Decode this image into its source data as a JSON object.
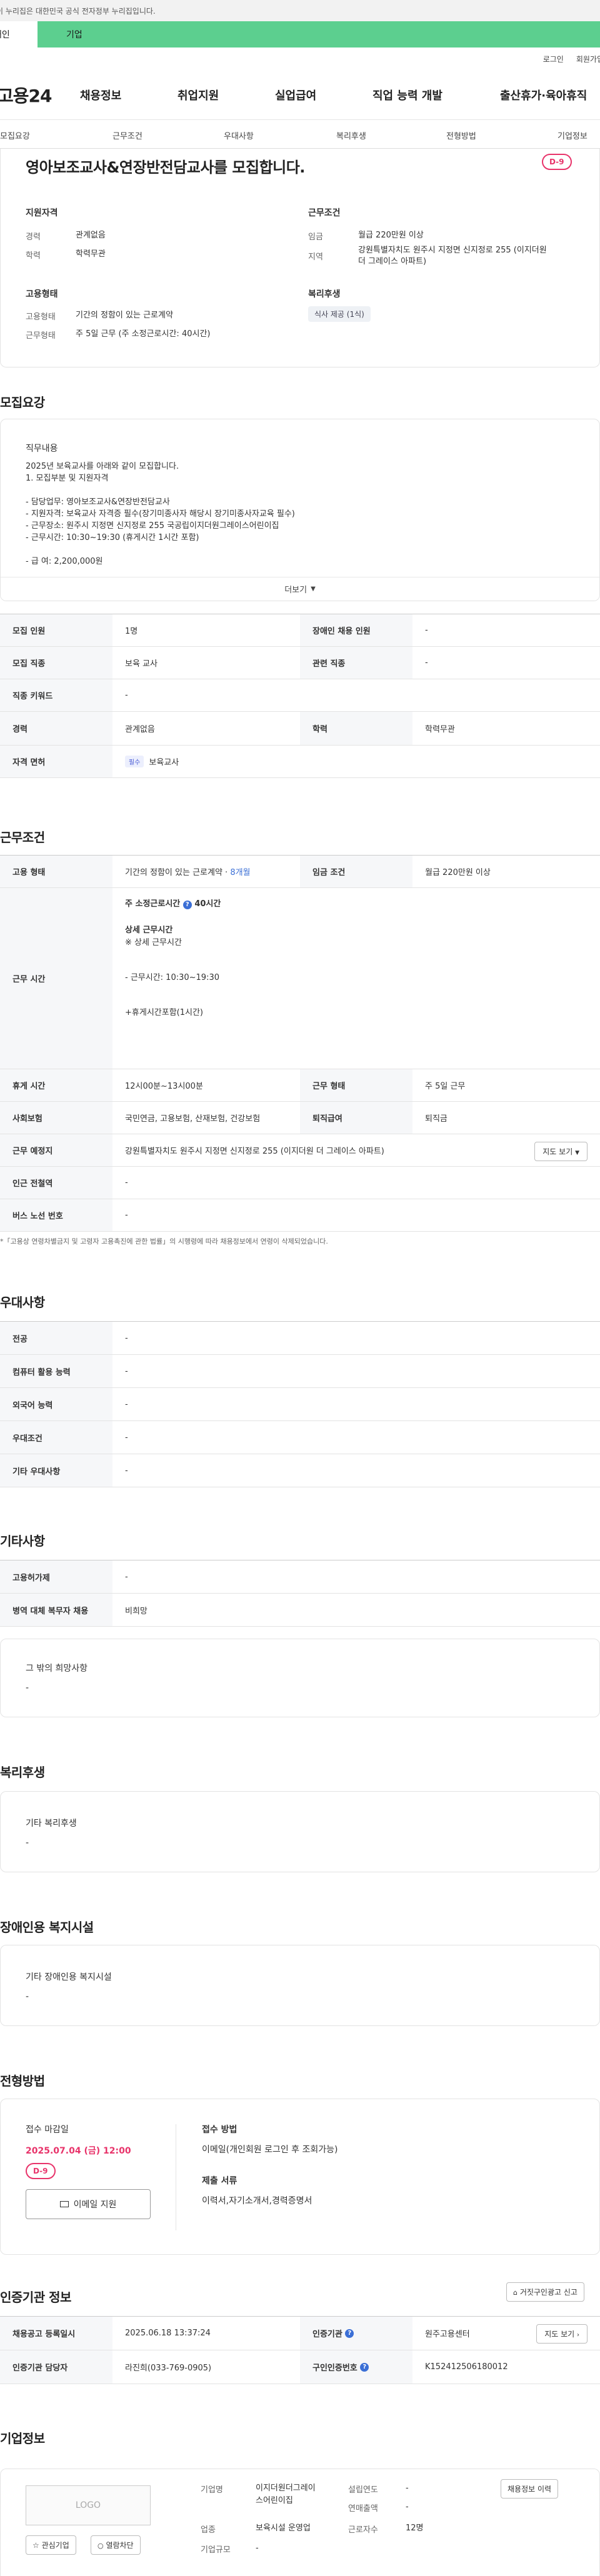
{
  "gov_notice": "이 누리집은 대한민국 공식 전자정부 누리집입니다.",
  "user_tabs": {
    "personal": "개인",
    "company": "기업"
  },
  "util": {
    "login": "로그인",
    "signup": "회원가입"
  },
  "gnb": {
    "logo": "고용24",
    "items": [
      "채용정보",
      "취업지원",
      "실업급여",
      "직업 능력 개발",
      "출산휴가·육아휴직"
    ]
  },
  "section_tabs": [
    "모집요강",
    "근무조건",
    "우대사항",
    "복리후생",
    "전형방법",
    "기업정보"
  ],
  "job": {
    "title": "영아보조교사&연장반전담교사를 모집합니다.",
    "dday": "D-9",
    "qual_h": "지원자격",
    "career_k": "경력",
    "career_v": "관계없음",
    "edu_k": "학력",
    "edu_v": "학력무관",
    "cond_h": "근무조건",
    "wage_k": "임금",
    "wage_v": "월급 220만원 이상",
    "region_k": "지역",
    "region_v1": "강원특별자치도 원주시 지정면 신지정로 255 (이지더원",
    "region_v2": "더 그레이스 아파트)",
    "emp_h": "고용형태",
    "emptype_k": "고용형태",
    "emptype_v": "기간의 정함이 있는 근로계약",
    "worktype_k": "근무형태",
    "worktype_v": "주 5일 근무 (주 소정근로시간: 40시간)",
    "welfare_h": "복리후생",
    "welfare_pill": "식사 제공 (1식)"
  },
  "recruit": {
    "title": "모집요강",
    "duty_h": "직무내용",
    "duty_lines": [
      "2025년 보육교사를 아래와 같이 모집합니다.",
      "1. 모집부분 및 지원자격",
      "",
      "- 담당업무: 영아보조교사&연장반전담교사",
      "- 지원자격: 보육교사 자격증 필수(장기미종사자 해당시 장기미종사자교육 필수)",
      "- 근무장소: 원주시 지정면 신지정로 255 국공립이지더원그레이스어린이집",
      "- 근무시간: 10:30~19:30 (휴게시간 1시간 포함)",
      "",
      "- 급 여: 2,200,000원"
    ],
    "more": "더보기",
    "rows": {
      "count_k": "모집 인원",
      "count_v": "1명",
      "disabled_k": "장애인 채용 인원",
      "disabled_v": "-",
      "job_k": "모집 직종",
      "job_v": "보육 교사",
      "related_k": "관련 직종",
      "related_v": "-",
      "keyword_k": "직종 키워드",
      "keyword_v": "-",
      "career_k": "경력",
      "career_v": "관계없음",
      "edu_k": "학력",
      "edu_v": "학력무관",
      "license_k": "자격 면허",
      "license_tag": "필수",
      "license_v": "보육교사"
    }
  },
  "work": {
    "title": "근무조건",
    "emp_k": "고용 형태",
    "emp_v": "기간의 정함이 있는 근로계약 · ",
    "emp_link": "8개월",
    "wage_k": "임금 조건",
    "wage_v": "월급 220만원 이상",
    "time_k": "근무 시간",
    "time_lines": [
      "주 소정근로시간",
      "40시간",
      "상세 근무시간",
      "※ 상세 근무시간",
      "- 근무시간: 10:30~19:30",
      "+휴게시간포함(1시간)"
    ],
    "rest_k": "휴게 시간",
    "rest_v": "12시00분~13시00분",
    "form_k": "근무 형태",
    "form_v": "주 5일 근무",
    "ins_k": "사회보험",
    "ins_v": "국민연금, 고용보험, 산재보험, 건강보험",
    "retire_k": "퇴직급여",
    "retire_v": "퇴직금",
    "place_k": "근무 예정지",
    "place_v": "강원특별자치도 원주시 지정면 신지정로 255 (이지더원 더 그레이스 아파트)",
    "map_btn": "지도 보기",
    "station_k": "인근 전철역",
    "station_v": "-",
    "bus_k": "버스 노선 번호",
    "bus_v": "-",
    "note": "*「고용상 연령차별금지 및 고령자 고용촉진에 관한 법률」의 시행령에 따라 채용정보에서 연령이 삭제되었습니다."
  },
  "pref": {
    "title": "우대사항",
    "rows": [
      {
        "k": "전공",
        "v": "-"
      },
      {
        "k": "컴퓨터 활용 능력",
        "v": "-"
      },
      {
        "k": "외국어 능력",
        "v": "-"
      },
      {
        "k": "우대조건",
        "v": "-"
      },
      {
        "k": "기타 우대사항",
        "v": "-"
      }
    ]
  },
  "etc": {
    "title": "기타사항",
    "rows": [
      {
        "k": "고용허가제",
        "v": "-"
      },
      {
        "k": "병역 대체 복무자 채용",
        "v": "비희망"
      }
    ],
    "other_h": "그 밖의 희망사항",
    "other_v": "-"
  },
  "welfare": {
    "title": "복리후생",
    "h": "기타 복리후생",
    "v": "-"
  },
  "disabled": {
    "title": "장애인용 복지시설",
    "h": "기타 장애인용 복지시설",
    "v": "-"
  },
  "apply": {
    "title": "전형방법",
    "deadline_h": "접수 마감일",
    "deadline_v": "2025.07.04 (금) 12:00",
    "dday": "D-9",
    "email_btn": "이메일 지원",
    "method_h": "접수 방법",
    "method_v": "이메일(개인회원 로그인 후 조회가능)",
    "docs_h": "제출 서류",
    "docs_v": "이력서,자기소개서,경력증명서"
  },
  "agency": {
    "title": "인증기관 정보",
    "report_btn": "거짓구인광고 신고",
    "reg_k": "채용공고 등록일시",
    "reg_v": "2025.06.18 13:37:24",
    "org_k": "인증기관",
    "org_v": "원주고용센터",
    "map_btn": "지도 보기",
    "staff_k": "인증기관 담당자",
    "staff_v": "라진희(033-769-0905)",
    "num_k": "구인인증번호",
    "num_v": "K152412506180012"
  },
  "company": {
    "title": "기업정보",
    "logo": "LOGO",
    "fav_btn": "관심기업",
    "block_btn": "열람차단",
    "name_k": "기업명",
    "name_v1": "이지더원더그레이",
    "name_v2": "스어린이집",
    "industry_k": "업종",
    "industry_v": "보육시설 운영업",
    "scale_k": "기업규모",
    "scale_v": "-",
    "founded_k": "설립연도",
    "founded_v": "-",
    "sales_k": "연매출액",
    "sales_v": "-",
    "staff_k": "근로자수",
    "staff_v": "12명",
    "history_btn": "채용정보 이력"
  }
}
